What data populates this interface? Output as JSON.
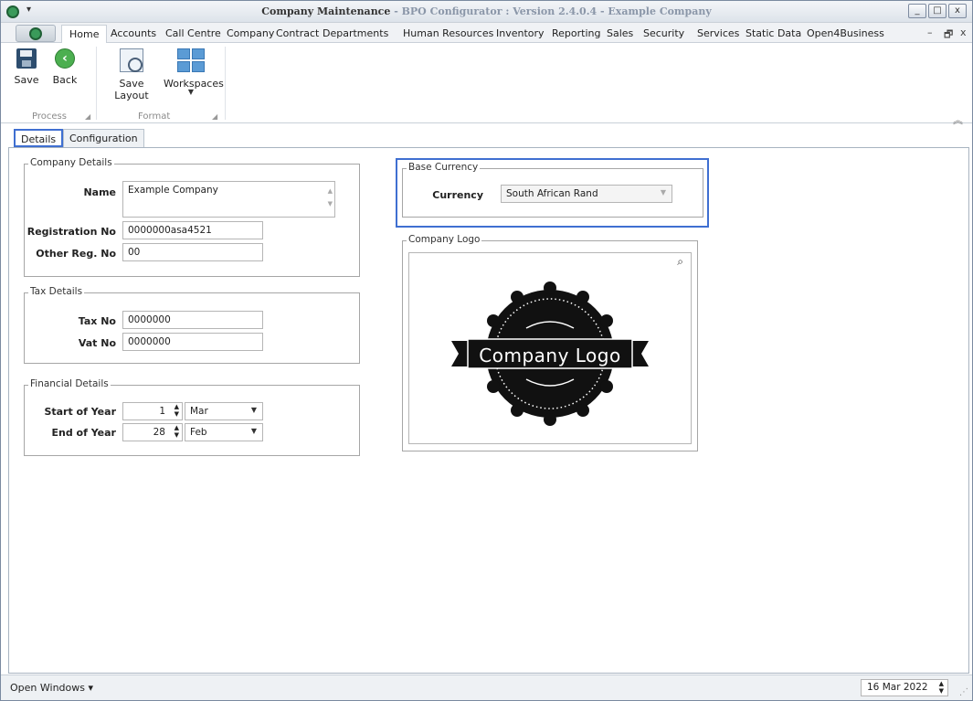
{
  "window": {
    "title_main": "Company Maintenance",
    "title_sub": " - BPO Configurator : Version 2.4.0.4 - Example Company",
    "minimize": "_",
    "maximize": "□",
    "close": "x"
  },
  "ribbon": {
    "tabs": [
      "Home",
      "Accounts",
      "Call Centre",
      "Company",
      "Contract",
      "Departments",
      "Human Resources",
      "Inventory",
      "Reporting",
      "Sales",
      "Security",
      "Services",
      "Static Data",
      "Open4Business"
    ],
    "active_tab": "Home",
    "buttons": {
      "save": "Save",
      "back": "Back",
      "save_layout": "Save Layout",
      "workspaces": "Workspaces"
    },
    "groups": {
      "process": "Process",
      "format": "Format"
    },
    "mdi_min": "–",
    "mdi_restore": "🗗",
    "mdi_close": "x"
  },
  "doc_tabs": [
    "Details",
    "Configuration"
  ],
  "company_details": {
    "legend": "Company Details",
    "name_label": "Name",
    "name_value": "Example Company",
    "reg_label": "Registration No",
    "reg_value": "0000000asa4521",
    "other_label": "Other Reg. No",
    "other_value": "00"
  },
  "tax_details": {
    "legend": "Tax Details",
    "tax_label": "Tax No",
    "tax_value": "0000000",
    "vat_label": "Vat No",
    "vat_value": "0000000"
  },
  "financial_details": {
    "legend": "Financial Details",
    "start_label": "Start of Year",
    "start_day": "1",
    "start_month": "Mar",
    "end_label": "End of Year",
    "end_day": "28",
    "end_month": "Feb"
  },
  "base_currency": {
    "legend": "Base Currency",
    "currency_label": "Currency",
    "currency_value": "South African Rand"
  },
  "company_logo": {
    "legend": "Company Logo",
    "logo_text": "Company Logo"
  },
  "statusbar": {
    "open_windows": "Open Windows ▾",
    "date": "16 Mar 2022"
  },
  "icons": [
    "app-icon",
    "save-icon",
    "back-icon",
    "save-layout-icon",
    "workspaces-icon",
    "search-icon",
    "collapse-ribbon-icon"
  ],
  "colors": {
    "highlight": "#3f6fd1",
    "title_sub": "#8a96a8"
  }
}
